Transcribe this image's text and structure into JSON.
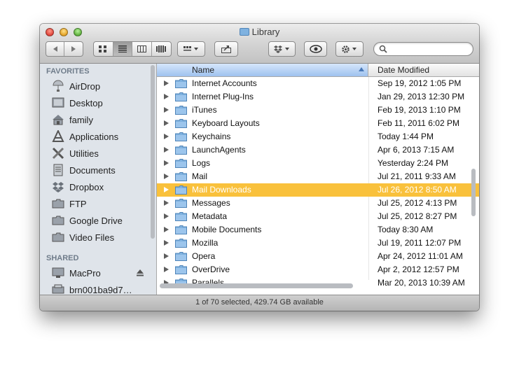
{
  "window": {
    "title": "Library"
  },
  "toolbar": {
    "view_icons": [
      "icon-view-icon",
      "list-view-icon",
      "column-view-icon",
      "coverflow-view-icon"
    ],
    "search_placeholder": ""
  },
  "sidebar": {
    "favorites_header": "FAVORITES",
    "favorites": [
      {
        "label": "AirDrop",
        "icon": "airdrop-icon"
      },
      {
        "label": "Desktop",
        "icon": "desktop-icon"
      },
      {
        "label": "family",
        "icon": "home-icon"
      },
      {
        "label": "Applications",
        "icon": "applications-icon"
      },
      {
        "label": "Utilities",
        "icon": "utilities-icon"
      },
      {
        "label": "Documents",
        "icon": "documents-icon"
      },
      {
        "label": "Dropbox",
        "icon": "dropbox-icon"
      },
      {
        "label": "FTP",
        "icon": "folder-icon"
      },
      {
        "label": "Google Drive",
        "icon": "folder-icon"
      },
      {
        "label": "Video Files",
        "icon": "folder-icon"
      }
    ],
    "shared_header": "SHARED",
    "shared": [
      {
        "label": "MacPro",
        "icon": "computer-icon"
      },
      {
        "label": "brn001ba9d7…",
        "icon": "printer-icon"
      }
    ]
  },
  "columns": {
    "name": "Name",
    "date": "Date Modified"
  },
  "files": [
    {
      "name": "Internet Accounts",
      "date": "Sep 19, 2012 1:05 PM"
    },
    {
      "name": "Internet Plug-Ins",
      "date": "Jan 29, 2013 12:30 PM"
    },
    {
      "name": "iTunes",
      "date": "Feb 19, 2013 1:10 PM"
    },
    {
      "name": "Keyboard Layouts",
      "date": "Feb 11, 2011 6:02 PM"
    },
    {
      "name": "Keychains",
      "date": "Today 1:44 PM"
    },
    {
      "name": "LaunchAgents",
      "date": "Apr 6, 2013 7:15 AM"
    },
    {
      "name": "Logs",
      "date": "Yesterday 2:24 PM"
    },
    {
      "name": "Mail",
      "date": "Jul 21, 2011 9:33 AM"
    },
    {
      "name": "Mail Downloads",
      "date": "Jul 26, 2012 8:50 AM",
      "selected": true
    },
    {
      "name": "Messages",
      "date": "Jul 25, 2012 4:13 PM"
    },
    {
      "name": "Metadata",
      "date": "Jul 25, 2012 8:27 PM"
    },
    {
      "name": "Mobile Documents",
      "date": "Today 8:30 AM"
    },
    {
      "name": "Mozilla",
      "date": "Jul 19, 2011 12:07 PM"
    },
    {
      "name": "Opera",
      "date": "Apr 24, 2012 11:01 AM"
    },
    {
      "name": "OverDrive",
      "date": "Apr 2, 2012 12:57 PM"
    },
    {
      "name": "Parallels",
      "date": "Mar 20, 2013 10:39 AM"
    }
  ],
  "status": {
    "text": "1 of 70 selected, 429.74 GB available"
  },
  "colors": {
    "selection": "#f9c13c",
    "folder": "#7fb2e0",
    "sidebar_bg": "#dfe4ea"
  }
}
